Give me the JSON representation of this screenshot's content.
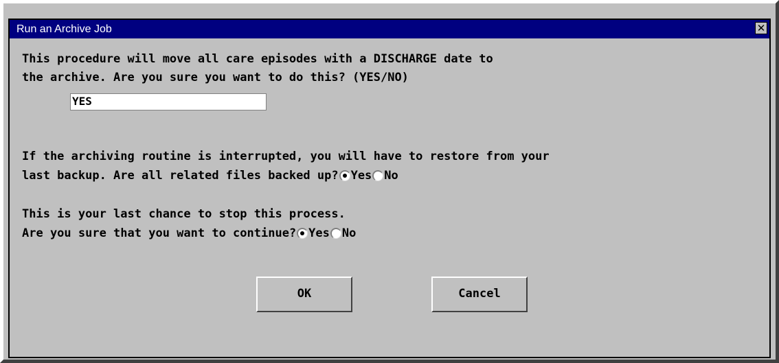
{
  "window": {
    "title": "Run an Archive Job",
    "close_glyph": "✕"
  },
  "prompt1": {
    "line1": "This procedure will move all care episodes with a DISCHARGE date to",
    "line2": "the archive. Are you sure you want to do this? (YES/NO)",
    "input_value": "YES"
  },
  "prompt2": {
    "line1": "If the archiving routine is interrupted, you will have to restore from your",
    "line2": "last backup. Are all related files backed up?",
    "options": [
      {
        "label": "Yes",
        "checked": true
      },
      {
        "label": "No",
        "checked": false
      }
    ]
  },
  "prompt3": {
    "line1": "This is your last chance to stop this process.",
    "line2": "Are you sure that you want to continue?",
    "options": [
      {
        "label": "Yes",
        "checked": true
      },
      {
        "label": "No",
        "checked": false
      }
    ]
  },
  "buttons": {
    "ok_label": "OK",
    "cancel_label": "Cancel"
  },
  "colors": {
    "titlebar": "#000080",
    "face": "#c0c0c0"
  }
}
